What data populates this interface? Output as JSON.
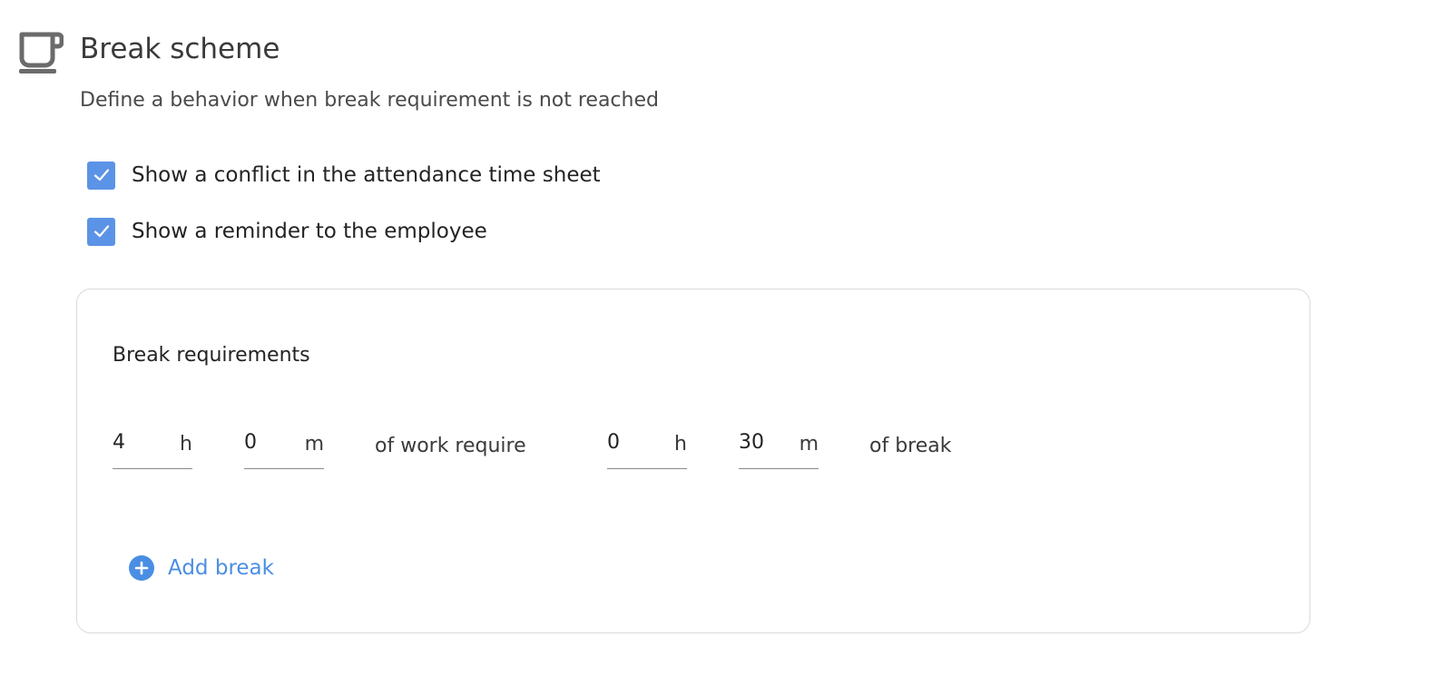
{
  "header": {
    "icon": "coffee-cup-icon",
    "title": "Break scheme",
    "subtitle": "Define a behavior when break requirement is not reached"
  },
  "options": [
    {
      "label": "Show a conflict in the attendance time sheet",
      "checked": true
    },
    {
      "label": "Show a reminder to the employee",
      "checked": true
    }
  ],
  "requirements": {
    "title": "Break requirements",
    "work_hours": {
      "value": "4",
      "unit": "h"
    },
    "work_minutes": {
      "value": "0",
      "unit": "m"
    },
    "middle_text": "of work require",
    "break_hours": {
      "value": "0",
      "unit": "h"
    },
    "break_minutes": {
      "value": "30",
      "unit": "m"
    },
    "end_text": "of break",
    "add_label": "Add break"
  },
  "colors": {
    "accent": "#4a8ee3",
    "checkbox": "#5b93e6",
    "icon_gray": "#6b6b6b",
    "border": "#dadada"
  }
}
